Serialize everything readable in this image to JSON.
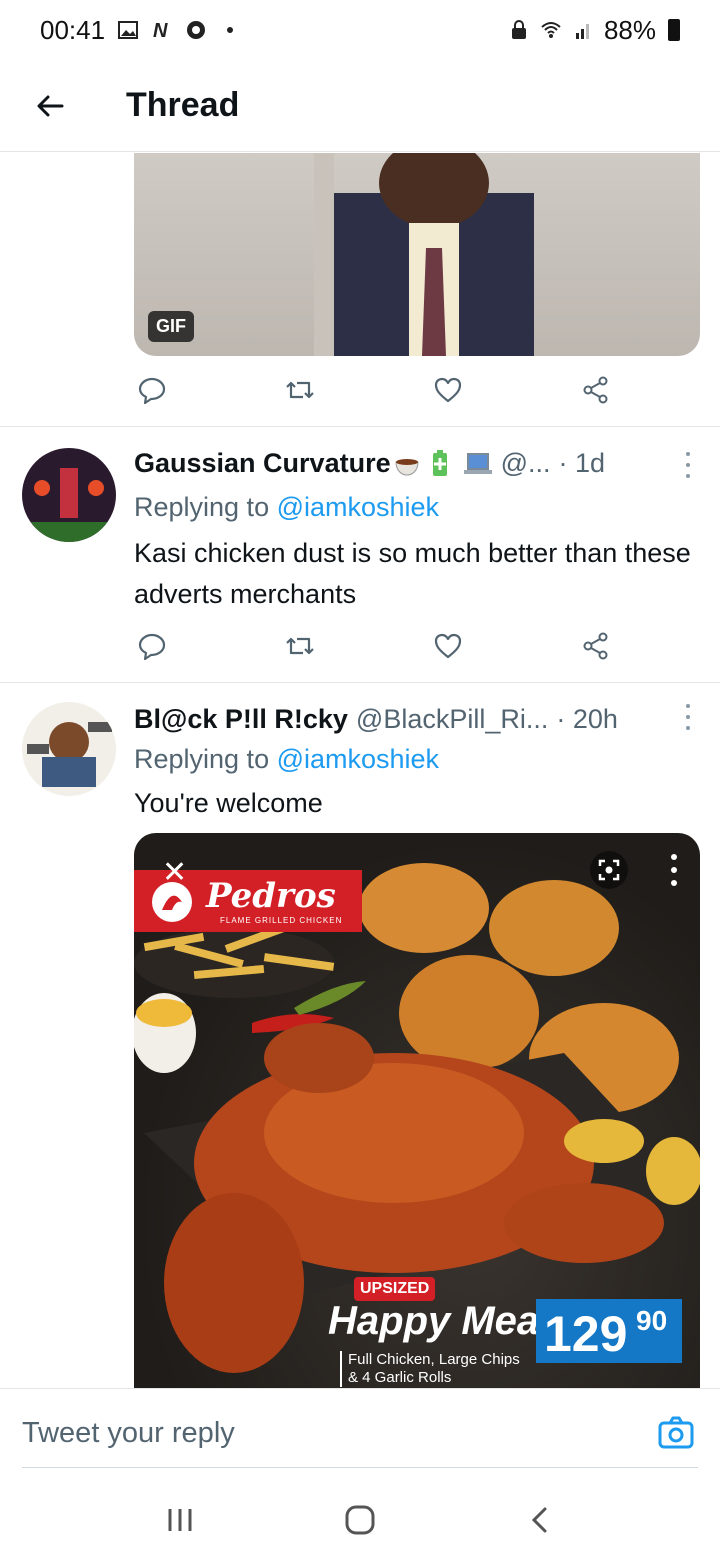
{
  "status_bar": {
    "time": "00:41",
    "battery": "88%",
    "left_icons": [
      "gallery-icon",
      "n-icon",
      "chrome-icon",
      "dot-icon"
    ],
    "right_icons": [
      "lock-icon",
      "wifi-icon",
      "signal-icon",
      "battery-icon"
    ]
  },
  "header": {
    "title": "Thread",
    "back_icon": "arrow-left-icon"
  },
  "gif_card": {
    "badge": "GIF"
  },
  "tweets": [
    {
      "name": "Gaussian Curvature",
      "emojis": [
        "coffee-emoji",
        "battery-emoji",
        "laptop-emoji"
      ],
      "handle": "@...",
      "time": "· 1d",
      "replying_prefix": "Replying to ",
      "replying_to": "@iamkoshiek",
      "text": "Kasi chicken dust is so much better than these adverts merchants"
    },
    {
      "name": "Bl@ck P!ll R!cky",
      "handle": "@BlackPill_Ri...",
      "time": "· 20h",
      "replying_prefix": "Replying to ",
      "replying_to": "@iamkoshiek",
      "text": "You're welcome"
    }
  ],
  "ad_image": {
    "brand": "Pedros",
    "brand_sub": "FLAME GRILLED CHICKEN",
    "close": "✕",
    "badge": "UPSIZED",
    "headline": "Happy Meal",
    "price_main": "129",
    "price_cents": "90",
    "subtitle_line1": "Full Chicken, Large Chips",
    "subtitle_line2": "& 4 Garlic Rolls"
  },
  "reply_bar": {
    "placeholder": "Tweet your reply"
  },
  "colors": {
    "accent": "#1d9bf0",
    "secondary_text": "#536471",
    "brand_red": "#d32027",
    "price_blue": "#1478c6"
  }
}
